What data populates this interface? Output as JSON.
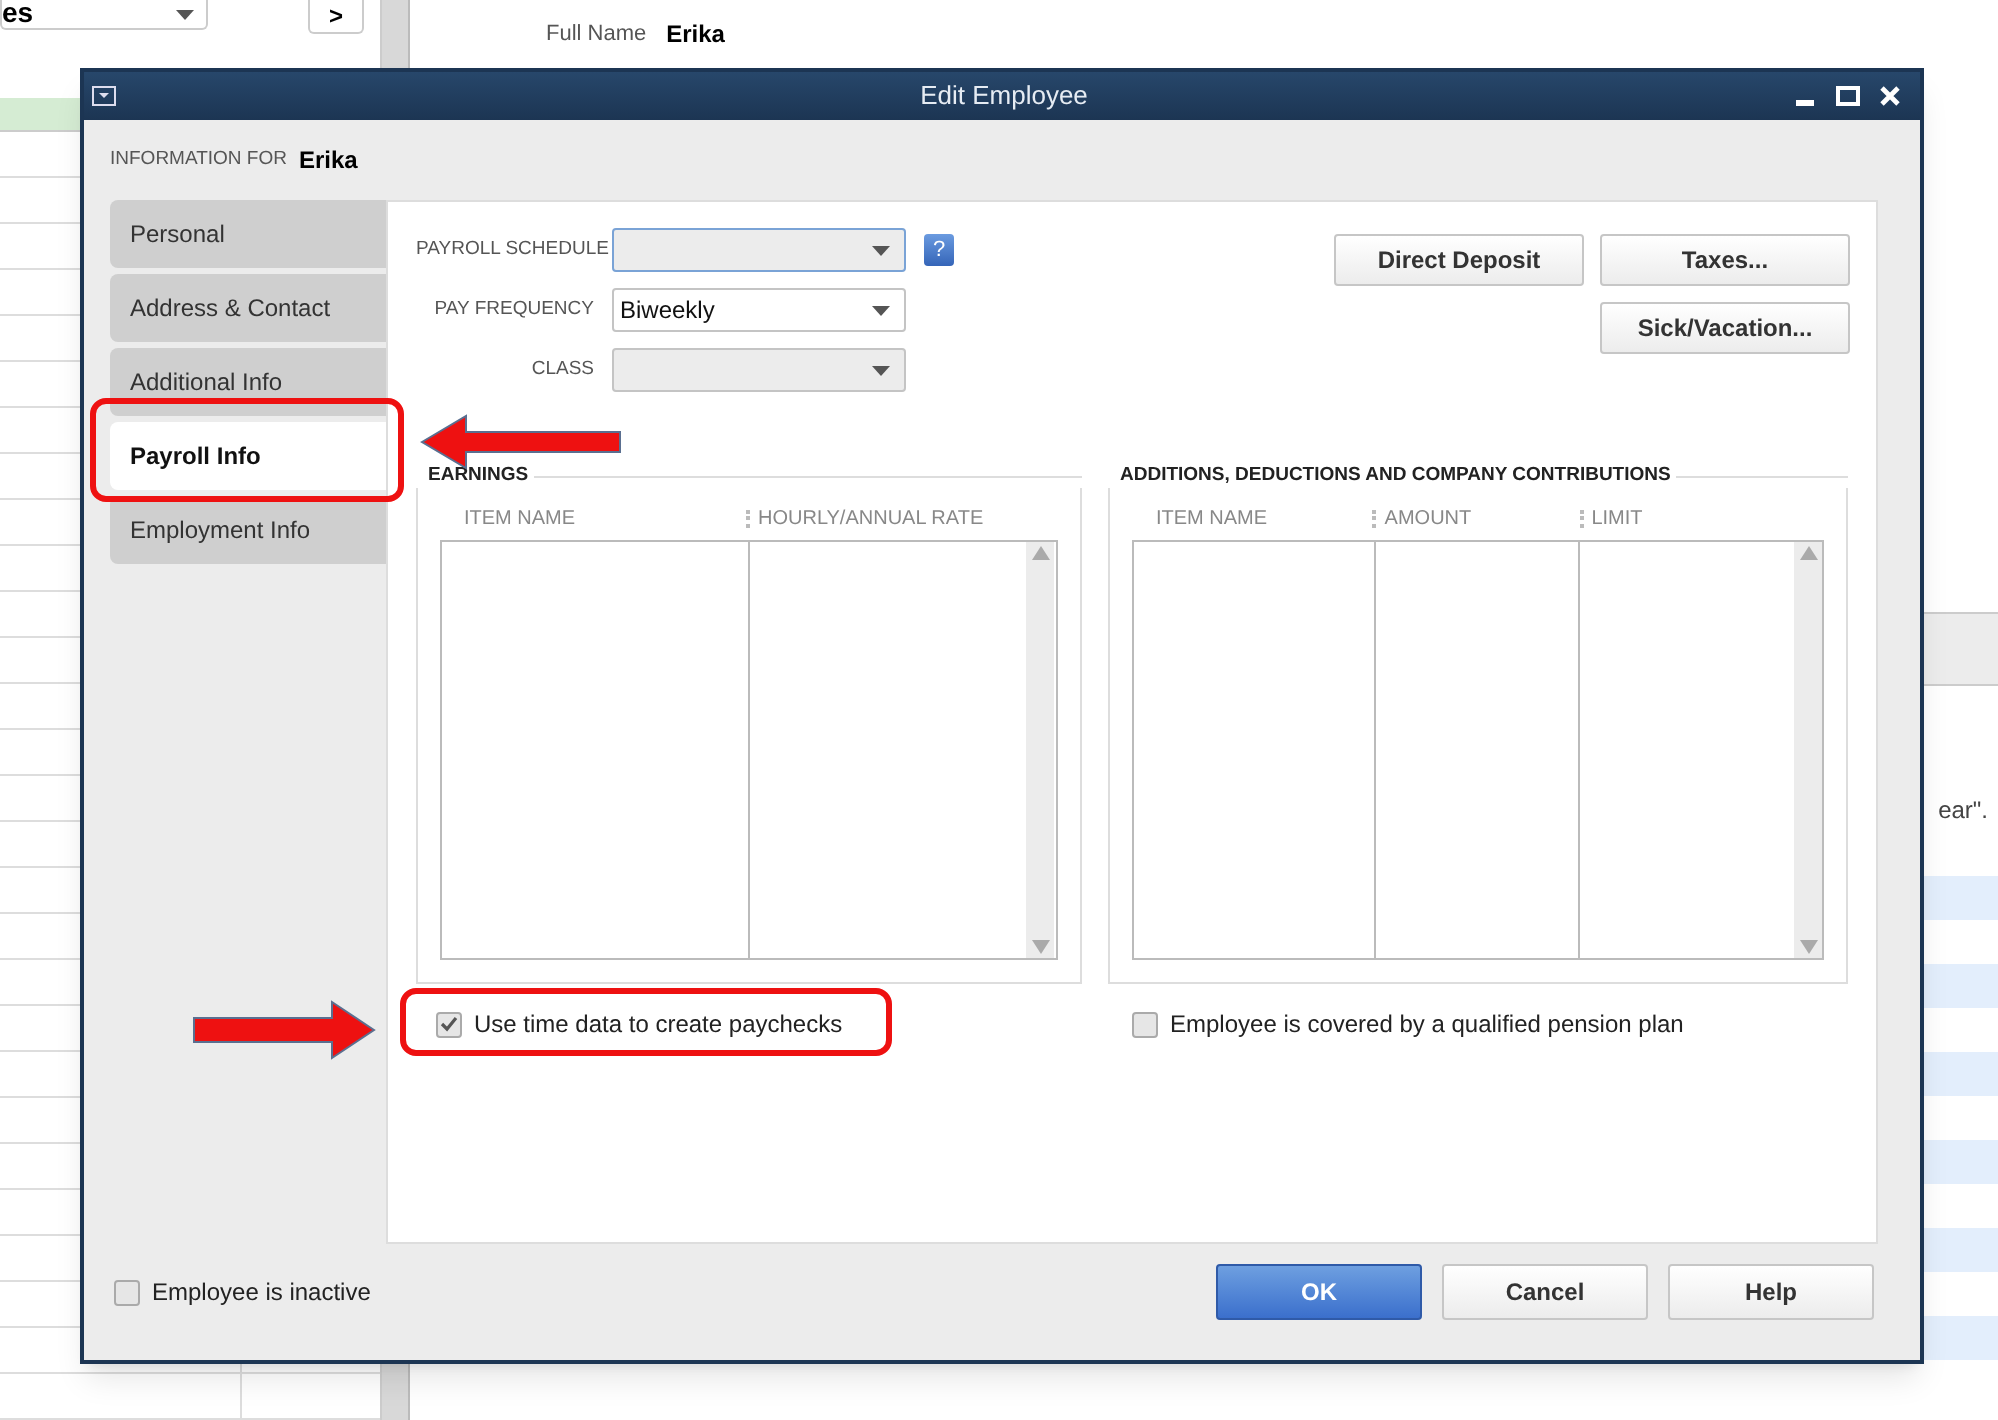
{
  "background": {
    "filter_dropdown": "es",
    "next_button": ">",
    "full_name_label": "Full Name",
    "full_name_value": "Erika",
    "note_fragment": "ear\"."
  },
  "dialog": {
    "title": "Edit Employee",
    "info_label": "INFORMATION FOR",
    "employee_name": "Erika",
    "tabs": [
      {
        "label": "Personal",
        "selected": false
      },
      {
        "label": "Address & Contact",
        "selected": false
      },
      {
        "label": "Additional Info",
        "selected": false
      },
      {
        "label": "Payroll Info",
        "selected": true
      },
      {
        "label": "Employment Info",
        "selected": false
      }
    ],
    "fields": [
      {
        "label": "PAYROLL SCHEDULE",
        "focused": true
      },
      {
        "label": "PAY FREQUENCY",
        "value": "Biweekly",
        "focused": false
      },
      {
        "label": "CLASS",
        "focused": false
      }
    ],
    "help_button": "?",
    "action_buttons": [
      {
        "label": "Direct Deposit"
      },
      {
        "label": "Taxes..."
      },
      {
        "label": "Sick/Vacation..."
      }
    ],
    "earnings": {
      "title": "EARNINGS",
      "columns": [
        "ITEM NAME",
        "HOURLY/ANNUAL RATE"
      ]
    },
    "additions": {
      "title": "ADDITIONS, DEDUCTIONS AND COMPANY CONTRIBUTIONS",
      "columns": [
        "ITEM NAME",
        "AMOUNT",
        "LIMIT"
      ]
    },
    "use_time_data": {
      "label": "Use time data to create paychecks",
      "checked": true
    },
    "pension_plan": {
      "label": "Employee is covered by a qualified pension plan",
      "checked": false
    },
    "inactive": {
      "label": "Employee is inactive",
      "checked": false
    },
    "footer_buttons": [
      {
        "label": "OK",
        "kind": "primary"
      },
      {
        "label": "Cancel",
        "kind": "normal"
      },
      {
        "label": "Help",
        "kind": "normal"
      }
    ]
  }
}
